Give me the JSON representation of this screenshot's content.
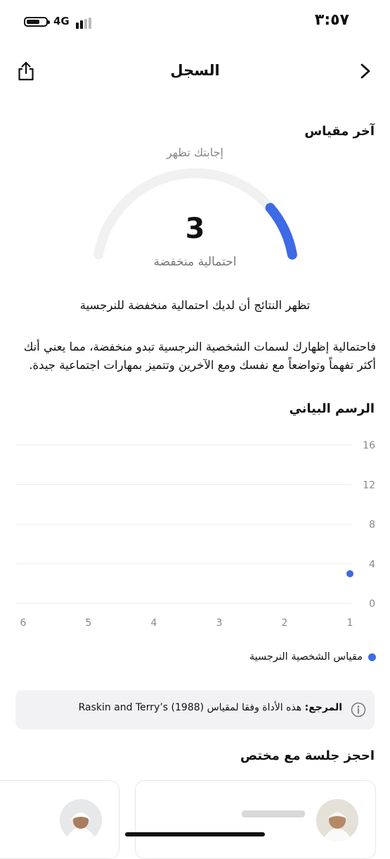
{
  "status_bar": {
    "time": "٣:٥٧",
    "network": "4G"
  },
  "header": {
    "title": "السجل",
    "share_icon": "share-icon",
    "back_icon": "chevron-right-icon"
  },
  "last_measure": {
    "section_title": "آخر مقياس",
    "subtitle": "إجابتك تظهر",
    "score": "3",
    "score_label": "احتمالية منخفضة",
    "gauge_fraction": 0.19,
    "gauge_color": "#3d6ae5",
    "result_line": "تظهر النتائج أن لديك احتمالية منخفضة للنرجسية",
    "description": "فاحتمالية إظهارك لسمات الشخصية النرجسية تبدو منخفضة، مما يعني أنك أكثر تفهماً وتواضعاً مع نفسك ومع الآخرين وتتميز بمهارات اجتماعية جيدة."
  },
  "chart_section": {
    "title": "الرسم البياني"
  },
  "chart_data": {
    "type": "scatter",
    "x": [
      1,
      2,
      3,
      4,
      5,
      6
    ],
    "x_ticks": [
      "1",
      "2",
      "3",
      "4",
      "5",
      "6"
    ],
    "y_ticks": [
      "0",
      "4",
      "8",
      "12",
      "16"
    ],
    "ylim": [
      0,
      16
    ],
    "grid": true,
    "series": [
      {
        "name": "مقياس الشخصية النرجسية",
        "color": "#3d6ae5",
        "points": [
          {
            "x": 1,
            "y": 3
          }
        ]
      }
    ],
    "legend_position": "bottom-right"
  },
  "reference": {
    "label": "المرجع:",
    "text": "هذه الأداة وفقا لمقياس (1988) Raskin and Terry’s",
    "icon": "info-icon"
  },
  "booking": {
    "title": "احجز جلسة مع مختص",
    "cards": [
      "specialist-card-1",
      "specialist-card-2"
    ]
  }
}
